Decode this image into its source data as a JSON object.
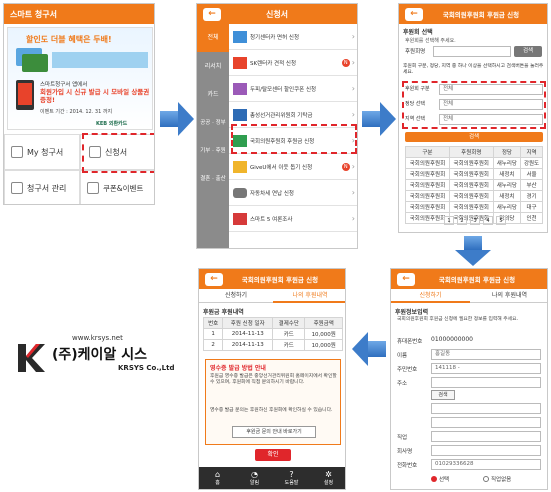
{
  "screen1": {
    "title": "스마트 청구서",
    "banner_headline": "할인도 더블 혜택은 두배!",
    "banner_sub1": "스마트청구서 앱에서",
    "banner_sub2": "회원가입 시 신규 발급 시 모바일 상품권 증정!",
    "banner_period": "이벤트 기간 : 2014. 12. 31 까지",
    "banner_bank": "KEB 외환카드",
    "menu": [
      {
        "label": "My 청구서",
        "icon": "bill-icon"
      },
      {
        "label": "신청서",
        "icon": "form-icon"
      },
      {
        "label": "청구서 관리",
        "icon": "manage-icon"
      },
      {
        "label": "쿠폰&이벤트",
        "icon": "coupon-icon"
      }
    ]
  },
  "screen2": {
    "title": "신청서",
    "categories": [
      "전체",
      "리서치",
      "카드",
      "공공 · 정부",
      "기부 · 후원",
      "결혼 · 출산"
    ],
    "items": [
      {
        "label": "청기센터카 면허 신청",
        "badge": "N"
      },
      {
        "label": "SK렌터카 견적 신청",
        "badge": "N"
      },
      {
        "label": "두피/탈모센터 할인쿠폰 신청",
        "badge": "N"
      },
      {
        "label": "총성선거관리위원회 기탁금",
        "badge": ""
      },
      {
        "label": "국회의원후원회 후원금 신청",
        "badge": "N"
      },
      {
        "label": "GiveU에서 이웃 돕기 신청",
        "badge": "N"
      },
      {
        "label": "자동차세 연납 신청",
        "badge": ""
      },
      {
        "label": "스마트 5 여론조사",
        "badge": ""
      }
    ]
  },
  "screen3": {
    "title": "국회의원후원회 후원금 신청",
    "section1": "후원회 선택",
    "section1_desc": "후원회를 선택해 주세요.",
    "name_label": "후원회명",
    "search_btn": "검색",
    "section2_desc": "후원회 구분, 정당, 지역 중 하나 이상을 선택하시고 검색버튼을 눌러주세요.",
    "filters": [
      {
        "label": "후원회 구분",
        "value": "전체"
      },
      {
        "label": "정당 선택",
        "value": "전체"
      },
      {
        "label": "지역 선택",
        "value": "전체"
      }
    ],
    "search_big": "검색",
    "table_headers": [
      "구분",
      "후원회명",
      "정당",
      "지역"
    ],
    "rows": [
      [
        "국회의원후원회",
        "국회의원후원회",
        "새누리당",
        "강원도"
      ],
      [
        "국회의원후원회",
        "국회의원후원회",
        "새정치",
        "서울"
      ],
      [
        "국회의원후원회",
        "국회의원후원회",
        "새누리당",
        "부산"
      ],
      [
        "국회의원후원회",
        "국회의원후원회",
        "새정치",
        "경기"
      ],
      [
        "국회의원후원회",
        "국회의원후원회",
        "새누리당",
        "대구"
      ],
      [
        "국회의원후원회",
        "국회의원후원회",
        "정의당",
        "인천"
      ]
    ],
    "pages": [
      "1",
      "2",
      "3",
      "4",
      "5"
    ]
  },
  "screen4": {
    "title": "국회의원후원회 후원금 신청",
    "tab_active": "신청하기",
    "tab_other": "나의 후원내역",
    "section": "후원정보입력",
    "desc": "국회의원후원회 후원금 신청에 필요한 정보를 입력해 주세요.",
    "fields": [
      {
        "label": "휴대폰번호",
        "value": "01000000000"
      },
      {
        "label": "이름",
        "value": "홍길동"
      },
      {
        "label": "주민번호",
        "value": "141118 -"
      },
      {
        "label": "주소",
        "value": ""
      },
      {
        "label": "",
        "value": ""
      },
      {
        "label": "직업",
        "value": ""
      },
      {
        "label": "회사명",
        "value": ""
      },
      {
        "label": "전화번호",
        "value": "01029336628"
      }
    ],
    "search_btn": "검색",
    "radio1": "선택",
    "radio2": "직업없음"
  },
  "screen5": {
    "title": "국회의원후원회 후원금 신청",
    "tab_other": "신청하기",
    "tab_active": "나의 후원내역",
    "section": "후원금 후원내역",
    "headers": [
      "번호",
      "후원 신청 일자",
      "결제수단",
      "후원금액"
    ],
    "rows": [
      [
        "1",
        "2014-11-13",
        "카드",
        "10,000원"
      ],
      [
        "2",
        "2014-11-13",
        "카드",
        "10,000원"
      ]
    ],
    "notice_title": "영수증 발급 방법 안내",
    "notice_text": "후원금 영수증 발급은 중앙선거관리위원회 홈페이지에서 확인할 수 있으며, 후원회에 직접 문의하시기 바랍니다.",
    "notice_text2": "영수증 발급 문의는 후원하신 후원회에 확인하실 수 있습니다.",
    "guide_btn": "후원금 문의 안내 바로가기",
    "confirm": "확인",
    "bottom_nav": [
      "홈",
      "알림",
      "도움말",
      "설정"
    ]
  },
  "brand": {
    "url": "www.krsys.net",
    "name": "(주)케이알 시스",
    "sub": "KRSYS Co.,Ltd"
  },
  "colors": {
    "accent": "#f07a1a",
    "highlight": "#e0262b",
    "arrow": "#3d7cc9"
  }
}
